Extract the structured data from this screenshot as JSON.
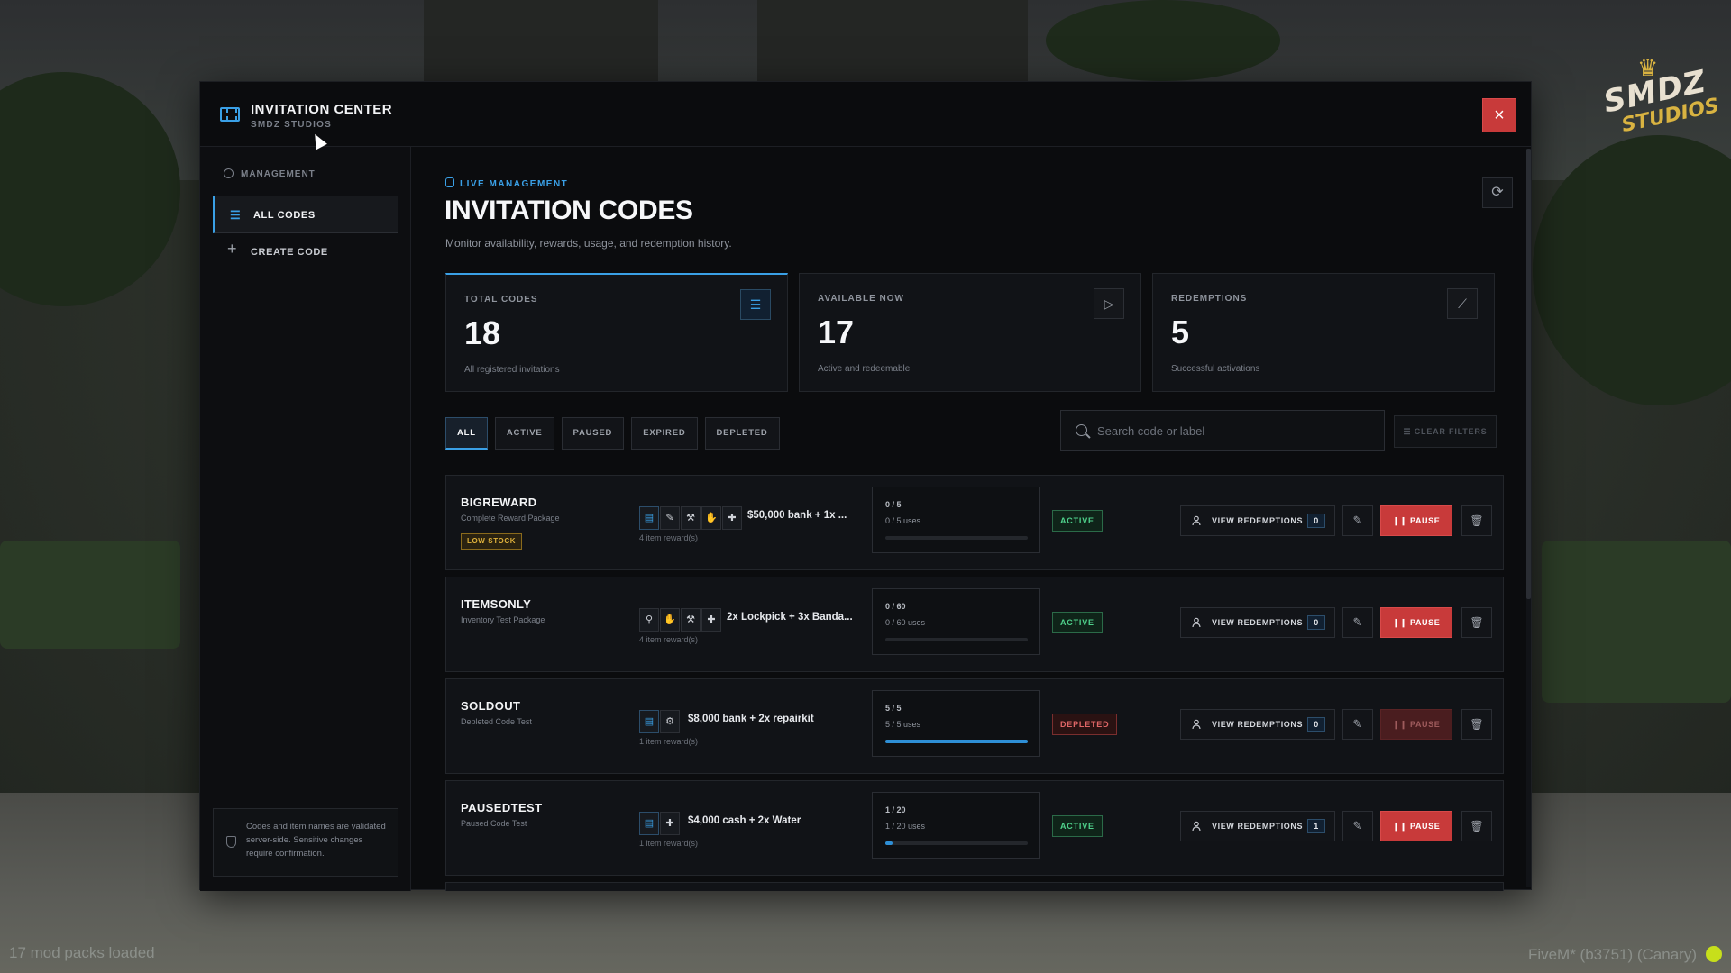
{
  "app": {
    "title": "INVITATION CENTER",
    "subtitle": "SMDZ STUDIOS",
    "close_label": "×"
  },
  "brand": {
    "wordmark": "SMDZ",
    "sub": "STUDIOS"
  },
  "sidebar": {
    "section": "MANAGEMENT",
    "items": [
      {
        "label": "ALL CODES",
        "icon": "list-icon",
        "active": true
      },
      {
        "label": "CREATE CODE",
        "icon": "plus-icon",
        "active": false
      }
    ],
    "note": "Codes and item names are validated server-side. Sensitive changes require confirmation."
  },
  "main": {
    "kicker": "LIVE MANAGEMENT",
    "title": "INVITATION CODES",
    "description": "Monitor availability, rewards, usage, and redemption history."
  },
  "stats": [
    {
      "label": "TOTAL CODES",
      "value": "18",
      "desc": "All registered invitations",
      "icon": "database-icon"
    },
    {
      "label": "AVAILABLE NOW",
      "value": "17",
      "desc": "Active and redeemable",
      "icon": "play-icon"
    },
    {
      "label": "REDEMPTIONS",
      "value": "5",
      "desc": "Successful activations",
      "icon": "chart-icon"
    }
  ],
  "filters": {
    "tabs": [
      "ALL",
      "ACTIVE",
      "PAUSED",
      "EXPIRED",
      "DEPLETED"
    ],
    "active_tab": "ALL",
    "search_placeholder": "Search code or label",
    "search_value": "",
    "clear_label": "CLEAR FILTERS"
  },
  "codes": [
    {
      "code": "BIGREWARD",
      "label": "Complete Reward Package",
      "tag": "LOW STOCK",
      "reward_text": "$50,000 bank + 1x ...",
      "reward_count": "4 item reward(s)",
      "usage_short": "0 / 5",
      "usage_long": "0 / 5 uses",
      "usage_ratio": 0,
      "status": "ACTIVE",
      "redemptions": "0",
      "view_label": "VIEW REDEMPTIONS",
      "pause_label": "PAUSE"
    },
    {
      "code": "ITEMSONLY",
      "label": "Inventory Test Package",
      "tag": "",
      "reward_text": "2x Lockpick + 3x Banda...",
      "reward_count": "4 item reward(s)",
      "usage_short": "0 / 60",
      "usage_long": "0 / 60 uses",
      "usage_ratio": 0,
      "status": "ACTIVE",
      "redemptions": "0",
      "view_label": "VIEW REDEMPTIONS",
      "pause_label": "PAUSE"
    },
    {
      "code": "SOLDOUT",
      "label": "Depleted Code Test",
      "tag": "",
      "reward_text": "$8,000 bank + 2x repairkit",
      "reward_count": "1 item reward(s)",
      "usage_short": "5 / 5",
      "usage_long": "5 / 5 uses",
      "usage_ratio": 1,
      "status": "DEPLETED",
      "redemptions": "0",
      "view_label": "VIEW REDEMPTIONS",
      "pause_label": "PAUSE"
    },
    {
      "code": "PAUSEDTEST",
      "label": "Paused Code Test",
      "tag": "",
      "reward_text": "$4,000 cash + 2x Water",
      "reward_count": "1 item reward(s)",
      "usage_short": "1 / 20",
      "usage_long": "1 / 20 uses",
      "usage_ratio": 0.05,
      "status": "ACTIVE",
      "redemptions": "1",
      "view_label": "VIEW REDEMPTIONS",
      "pause_label": "PAUSE"
    }
  ],
  "footer": {
    "left": "17 mod packs loaded",
    "right": "FiveM* (b3751) (Canary)"
  },
  "colors": {
    "accent": "#3aa0e6",
    "danger": "#c83a3a",
    "success": "#4fd18b",
    "warning": "#e0b23c"
  }
}
